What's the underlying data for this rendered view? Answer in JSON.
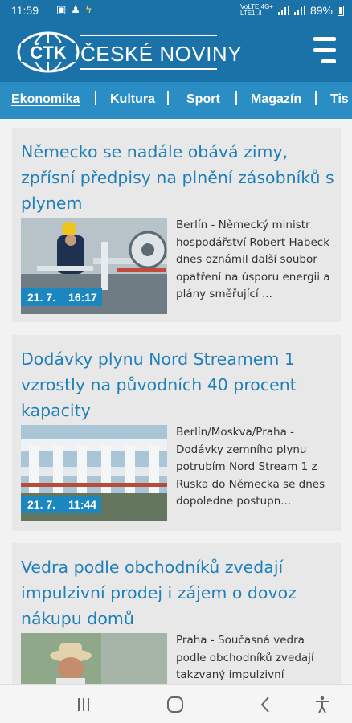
{
  "status_bar": {
    "time": "11:59",
    "left_icons": [
      "image-icon",
      "notification-icon",
      "charging-icon"
    ],
    "network": [
      "VoLTE 4G+",
      "LTE1 .il"
    ],
    "battery": "89%"
  },
  "header": {
    "logo_mark": "ČTK",
    "logo_text": "ČESKÉ NOVINY"
  },
  "categories": [
    {
      "label": "Ekonomika",
      "active": true
    },
    {
      "label": "Kultura",
      "active": false
    },
    {
      "label": "Sport",
      "active": false
    },
    {
      "label": "Magazín",
      "active": false
    },
    {
      "label": "Tis",
      "active": false
    }
  ],
  "articles": [
    {
      "title": "Německo se nadále obává zimy, zpřísní předpisy na plnění zásobníků s plynem",
      "date": "21. 7.",
      "time": "16:17",
      "excerpt": "Berlín - Německý ministr hospodářství Robert Habeck dnes oznámil další soubor opatření na úsporu energii a plány směřující ..."
    },
    {
      "title": "Dodávky plynu Nord Streamem 1 vzrostly na původních 40 procent kapacity",
      "date": "21. 7.",
      "time": "11:44",
      "excerpt": "Berlín/Moskva/Praha - Dodávky zemního plynu potrubím Nord Stream 1 z Ruska do Německa se dnes dopoledne postupn..."
    },
    {
      "title": "Vedra podle obchodníků zvedají impulzivní prodej i zájem o dovoz nákupu domů",
      "date": "",
      "time": "",
      "excerpt": "Praha - Současná vedra podle obchodníků zvedají takzvaný impulzivní"
    }
  ],
  "nav_bar": {
    "buttons": [
      "recent-apps-icon",
      "home-icon",
      "back-icon",
      "accessibility-icon"
    ]
  },
  "colors": {
    "header": "#1a72a9",
    "category_bar": "#2a8ec4",
    "title": "#1f7fb8",
    "date_stamp": "#1c86bf"
  }
}
